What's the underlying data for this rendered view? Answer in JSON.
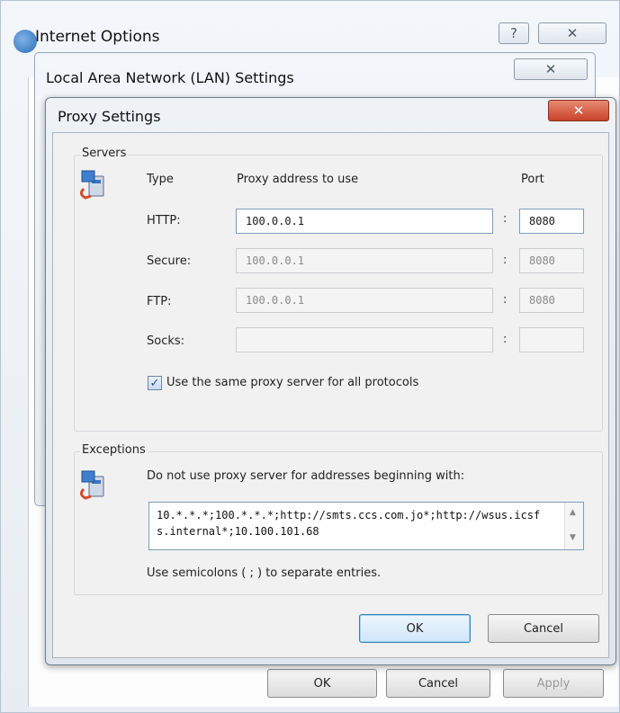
{
  "internet_options": {
    "title": "Internet Options",
    "help_icon": "help-icon",
    "close_icon": "close-icon",
    "buttons": {
      "ok": "OK",
      "cancel": "Cancel",
      "apply": "Apply"
    }
  },
  "lan_settings": {
    "title": "Local Area Network (LAN) Settings",
    "close_icon": "close-icon"
  },
  "proxy_settings": {
    "title": "Proxy Settings",
    "close_icon": "close-icon",
    "close_color": "#c9432a",
    "servers": {
      "group_label": "Servers",
      "icon": "network-icon",
      "col_type": "Type",
      "col_address": "Proxy address to use",
      "col_port": "Port",
      "rows": [
        {
          "type": "HTTP:",
          "address": "100.0.0.1",
          "port": "8080"
        },
        {
          "type": "Secure:",
          "address": "100.0.0.1",
          "port": "8080"
        },
        {
          "type": "FTP:",
          "address": "100.0.0.1",
          "port": "8080"
        },
        {
          "type": "Socks:",
          "address": "",
          "port": ""
        }
      ],
      "colon": ":",
      "same_proxy_label": "Use the same proxy server for all protocols",
      "same_proxy_checked": true
    },
    "exceptions": {
      "group_label": "Exceptions",
      "icon": "network-icon",
      "description": "Do not use proxy server for addresses beginning with:",
      "value": "10.*.*.*;100.*.*.*;http://smts.ccs.com.jo*;http://wsus.icsfs.internal*;10.100.101.68",
      "hint": "Use semicolons ( ; ) to separate entries."
    },
    "buttons": {
      "ok": "OK",
      "cancel": "Cancel"
    },
    "accent_color": "#3d8fd6"
  }
}
